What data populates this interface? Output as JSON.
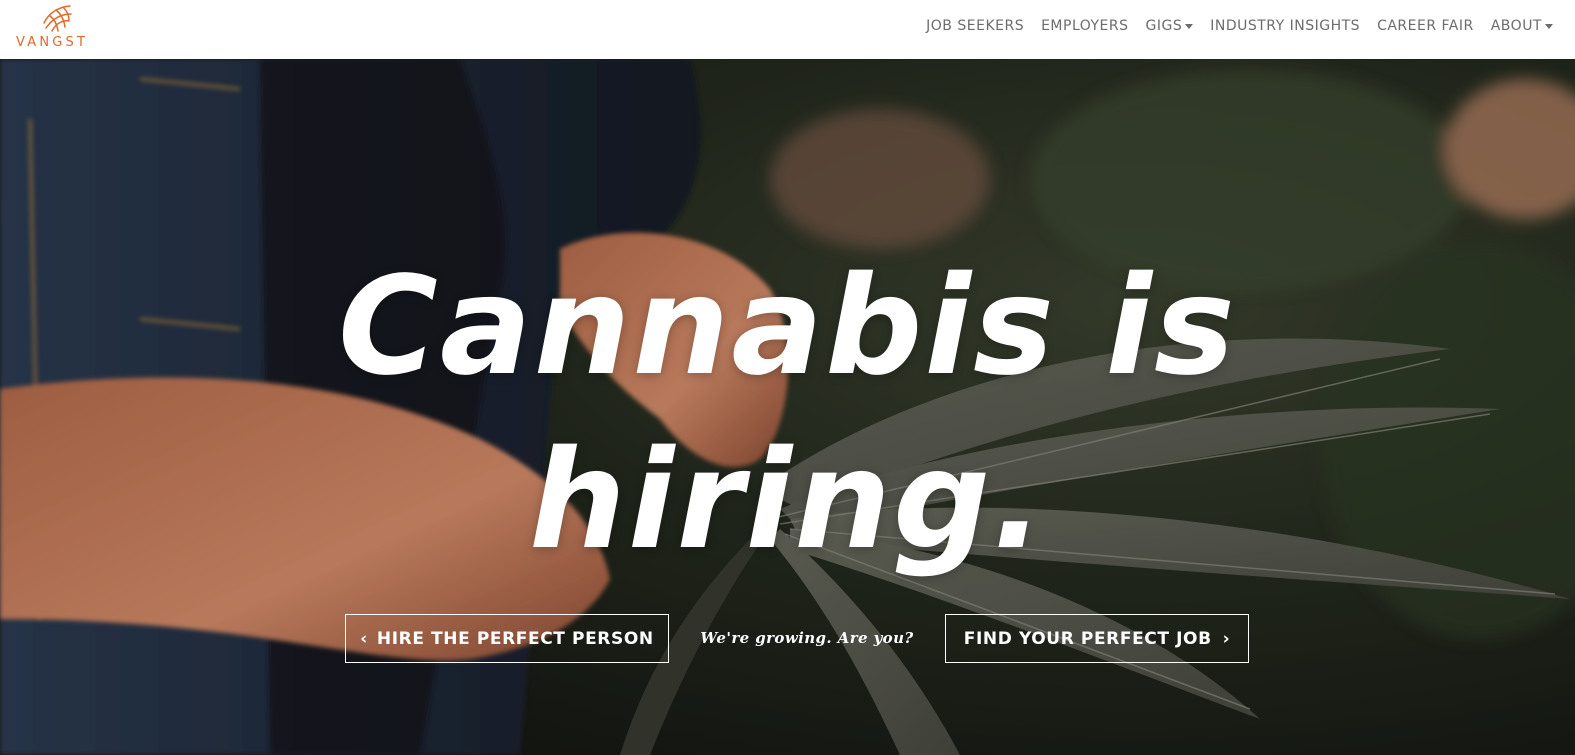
{
  "brand": {
    "name": "VANGST",
    "color": "#e06a2c"
  },
  "nav": {
    "items": [
      {
        "label": "JOB SEEKERS",
        "dropdown": false
      },
      {
        "label": "EMPLOYERS",
        "dropdown": false
      },
      {
        "label": "GIGS",
        "dropdown": true
      },
      {
        "label": "INDUSTRY INSIGHTS",
        "dropdown": false
      },
      {
        "label": "CAREER FAIR",
        "dropdown": false
      },
      {
        "label": "ABOUT",
        "dropdown": true
      }
    ],
    "text_color": "#6c6c6c"
  },
  "hero": {
    "headline_line1": "Cannabis is",
    "headline_line2": "hiring.",
    "hire_button": {
      "label": "HIRE THE PERFECT PERSON",
      "icon": "chevron-left-icon"
    },
    "tagline": "We're growing. Are you?",
    "find_button": {
      "label": "FIND YOUR PERFECT JOB",
      "icon": "chevron-right-icon"
    }
  }
}
